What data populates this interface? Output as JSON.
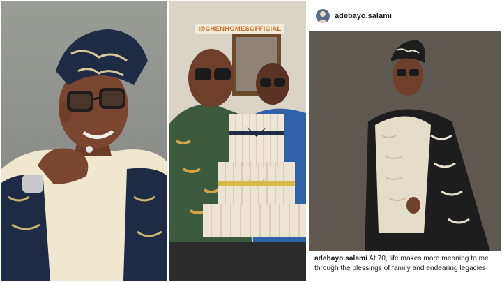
{
  "panels": {
    "left_photo": {
      "icon": "portrait-photo"
    },
    "middle_story": {
      "tag": "@CHENHOMESOFFICIAL",
      "icon": "money-cake-photo"
    },
    "right_post": {
      "username": "adebayo.salami",
      "caption_user": "adebayo.salami",
      "caption_text": " At 70, life makes more meaning to me through the blessings of family and endearing legacies"
    }
  },
  "colors": {
    "agbada_navy": "#1f2b45",
    "agbada_cream": "#e8e1c8",
    "tag_orange": "#c26f2c"
  }
}
